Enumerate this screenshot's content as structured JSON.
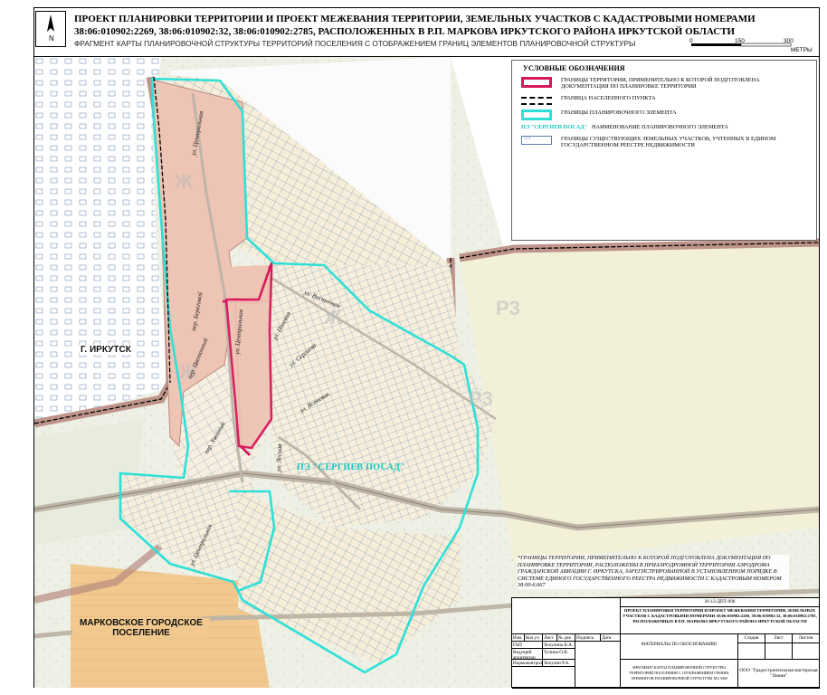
{
  "header": {
    "title": "ПРОЕКТ ПЛАНИРОВКИ ТЕРРИТОРИИ И ПРОЕКТ МЕЖЕВАНИЯ ТЕРРИТОРИИ, ЗЕМЕЛЬНЫХ УЧАСТКОВ С КАДАСТРОВЫМИ НОМЕРАМИ 38:06:010902:2269, 38:06:010902:32, 38:06:010902:2785, РАСПОЛОЖЕННЫХ В Р.П. МАРКОВА ИРКУТСКОГО РАЙОНА ИРКУТСКОЙ ОБЛАСТИ",
    "subtitle": "ФРАГМЕНТ КАРТЫ ПЛАНИРОВОЧНОЙ СТРУКТУРЫ ТЕРРИТОРИЙ ПОСЕЛЕНИЯ С ОТОБРАЖЕНИЕМ ГРАНИЦ ЭЛЕМЕНТОВ ПЛАНИРОВОЧНОЙ СТРУКТУРЫ",
    "north_label": "N"
  },
  "scale": {
    "t0": "0",
    "t1": "150",
    "t2": "300",
    "unit": "МЕТРЫ"
  },
  "legend": {
    "title": "УСЛОВНЫЕ ОБОЗНАЧЕНИЯ",
    "items": [
      {
        "text": "ГРАНИЦЫ ТЕРРИТОРИИ, ПРИМЕНИТЕЛЬНО К КОТОРОЙ ПОДГОТОВЛЕНА ДОКУМЕНТАЦИЯ ПО ПЛАНИРОВКЕ ТЕРРИТОРИИ"
      },
      {
        "text": "ГРАНИЦА НАСЕЛЕННОГО ПУНКТА"
      },
      {
        "text": "ГРАНИЦЫ ПЛАНИРОВОЧНОГО ЭЛЕМЕНТА"
      },
      {
        "symbol": "ПЭ \"СЕРГИЕВ ПОСАД\"",
        "text": "НАИМЕНОВАНИЕ ПЛАНИРОВОЧНОГО ЭЛЕМЕНТА"
      },
      {
        "symbol": ":1/1",
        "text": "ГРАНИЦЫ СУЩЕСТВУЮЩИХ ЗЕМЕЛЬНЫХ УЧАСТКОВ, УЧТЕННЫХ В ЕДИНОМ ГОСУДАРСТВЕННОМ РЕЕСТРЕ НЕДВИЖИМОСТИ"
      }
    ]
  },
  "map": {
    "city_irkutsk": "Г. ИРКУТСК",
    "markovo_line1": "МАРКОВСКОЕ ГОРОДСКОЕ",
    "markovo_line2": "ПОСЕЛЕНИЕ",
    "pe_label": "ПЭ \"СЕРГИЕВ ПОСАД\"",
    "streets": {
      "tsentralnaya_top": "ул. Центральная",
      "tsentralnaya_mid": "ул. Центральная",
      "tsentralnaya_low": "ул. Центральная",
      "beregovaya": "пер. Береговой",
      "tsvetochny": "пер. Цветочный",
      "khvoyny": "пер. Хвойный",
      "polevaya": "ул. Полевая",
      "sergieva": "ул. Сергиева",
      "yasenevaya": "ул. Ясеневая",
      "lesnaya": "ул. Лесная",
      "vostochnaya": "ул. Восточная"
    },
    "colors": {
      "project_boundary": "#d9175c",
      "settlement_boundary_fill": "#b88a80",
      "planning_element": "#2fe0d6",
      "project_area_fill": "#eec4b4",
      "parcel_lines": "#4a6f9e"
    }
  },
  "note": "*ГРАНИЦЫ ТЕРРИТОРИИ, ПРИМЕНИТЕЛЬНО К КОТОРОЙ ПОДГОТОВЛЕНА ДОКУМЕНТАЦИЯ ПО ПЛАНИРОВКЕ ТЕРРИТОРИИ, РАСПОЛОЖЕНЫ В ПРИАЭРОДРОМНОЙ ТЕРРИТОРИИ АЭРОДРОМА ГРАЖДАНСКОЙ АВИАЦИИ Г. ИРКУТСКА, ЗАРЕГИСТРИРОВАННОЙ В УСТАНОВЛЕННОМ ПОРЯДКЕ В СИСТЕМЕ ЕДИНОГО ГОСУДАРСТВЕННОГО РЕЕСТРА НЕДВИЖИМОСТИ С КАДАСТРОВЫМ НОМЕРОМ 38:00-6.667",
  "stamp": {
    "code": "26-12-ДПТ-090",
    "project": "ПРОЕКТ ПЛАНИРОВКИ ТЕРРИТОРИИ И ПРОЕКТ МЕЖЕВАНИЯ ТЕРРИТОРИИ, ЗЕМЕЛЬНЫХ УЧАСТКОВ С КАДАСТРОВЫМИ НОМЕРАМИ 38:06:010902:2269, 38:06:010902:32, 38:06:010902:2785, РАСПОЛОЖЕННЫХ В Р.П. МАРКОВА ИРКУТСКОГО РАЙОНА ИРКУТСКОЙ ОБЛАСТИ",
    "headers": [
      "Изм.",
      "Кол.уч",
      "Лист",
      "№ док",
      "Подпись",
      "Дата"
    ],
    "roles": [
      "ГАП",
      "Ведущий архитектор",
      "Нормоконтроль"
    ],
    "names": [
      "Хохулина В.А.",
      "Тучина О.В.",
      "Хохулин Р.А."
    ],
    "materials": "МАТЕРИАЛЫ ПО ОБОСНОВАНИЮ",
    "sheet_desc": "ФРАГМЕНТ КАРТЫ ПЛАНИРОВОЧНОЙ СТРУКТУРЫ ТЕРРИТОРИЙ ПОСЕЛЕНИЯ С ОТОБРАЖЕНИЕМ ГРАНИЦ ЭЛЕМЕНТОВ ПЛАНИРОВОЧНОЙ СТРУКТУРЫ М1:5000",
    "stage_h": "Стадия",
    "sheet_h": "Лист",
    "sheets_h": "Листов",
    "org": "ООО \"Градостроительная мастерская \"Линия\""
  }
}
